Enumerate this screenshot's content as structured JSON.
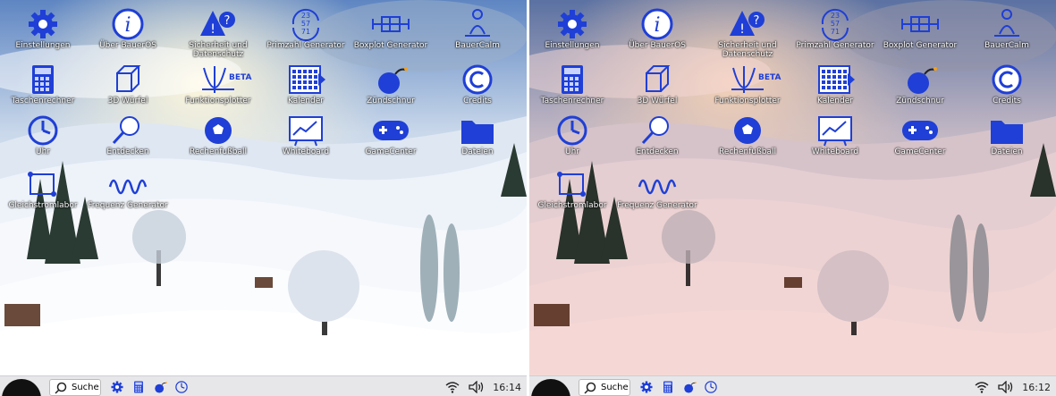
{
  "screens": [
    {
      "desktop": {
        "icons": [
          {
            "label": "Einstellungen",
            "icon": "gear-icon"
          },
          {
            "label": "Über BauerOS",
            "icon": "info-icon"
          },
          {
            "label": "Sicherheit und Datenschutz",
            "icon": "warning-icon"
          },
          {
            "label": "Primzahl Generator",
            "icon": "prime-cycle-icon"
          },
          {
            "label": "Boxplot Generator",
            "icon": "boxplot-icon"
          },
          {
            "label": "BauerCalm",
            "icon": "meditation-icon"
          },
          {
            "label": "Taschenrechner",
            "icon": "calculator-icon"
          },
          {
            "label": "3D Würfel",
            "icon": "cube-icon"
          },
          {
            "label": "Funktionsplotter",
            "icon": "function-plot-icon",
            "badge": "BETA"
          },
          {
            "label": "Kalender",
            "icon": "calendar-icon"
          },
          {
            "label": "Zündschnur",
            "icon": "bomb-icon"
          },
          {
            "label": "Credits",
            "icon": "copyright-icon"
          },
          {
            "label": "Uhr",
            "icon": "clock-icon"
          },
          {
            "label": "Entdecken",
            "icon": "magnifier-icon"
          },
          {
            "label": "Rechenfußball",
            "icon": "football-icon"
          },
          {
            "label": "Whiteboard",
            "icon": "whiteboard-icon"
          },
          {
            "label": "GameCenter",
            "icon": "gamepad-icon"
          },
          {
            "label": "Dateien",
            "icon": "folder-icon"
          },
          {
            "label": "Gleichstromlabor",
            "icon": "circuit-icon"
          },
          {
            "label": "Frequenz Generator",
            "icon": "wave-icon"
          }
        ]
      },
      "taskbar": {
        "search_label": "Suche",
        "time": "16:14",
        "pinned": [
          "gear-icon",
          "calculator-icon",
          "bomb-icon",
          "clock-icon"
        ]
      }
    },
    {
      "desktop": {
        "icons": [
          {
            "label": "Einstellungen",
            "icon": "gear-icon"
          },
          {
            "label": "Über BauerOS",
            "icon": "info-icon"
          },
          {
            "label": "Sicherheit und Datenschutz",
            "icon": "warning-icon"
          },
          {
            "label": "Primzahl Generator",
            "icon": "prime-cycle-icon"
          },
          {
            "label": "Boxplot Generator",
            "icon": "boxplot-icon"
          },
          {
            "label": "BauerCalm",
            "icon": "meditation-icon"
          },
          {
            "label": "Taschenrechner",
            "icon": "calculator-icon"
          },
          {
            "label": "3D Würfel",
            "icon": "cube-icon"
          },
          {
            "label": "Funktionsplotter",
            "icon": "function-plot-icon",
            "badge": "BETA"
          },
          {
            "label": "Kalender",
            "icon": "calendar-icon"
          },
          {
            "label": "Zündschnur",
            "icon": "bomb-icon"
          },
          {
            "label": "Credits",
            "icon": "copyright-icon"
          },
          {
            "label": "Uhr",
            "icon": "clock-icon"
          },
          {
            "label": "Entdecken",
            "icon": "magnifier-icon"
          },
          {
            "label": "Rechenfußball",
            "icon": "football-icon"
          },
          {
            "label": "Whiteboard",
            "icon": "whiteboard-icon"
          },
          {
            "label": "GameCenter",
            "icon": "gamepad-icon"
          },
          {
            "label": "Dateien",
            "icon": "folder-icon"
          },
          {
            "label": "Gleichstromlabor",
            "icon": "circuit-icon"
          },
          {
            "label": "Frequenz Generator",
            "icon": "wave-icon"
          }
        ]
      },
      "taskbar": {
        "search_label": "Suche",
        "time": "16:12",
        "pinned": [
          "gear-icon",
          "calculator-icon",
          "bomb-icon",
          "clock-icon"
        ]
      }
    }
  ],
  "colors": {
    "icon_blue": "#1f3fd6",
    "taskbar": "#e7e7ea",
    "red_tint": "#c8281488"
  }
}
